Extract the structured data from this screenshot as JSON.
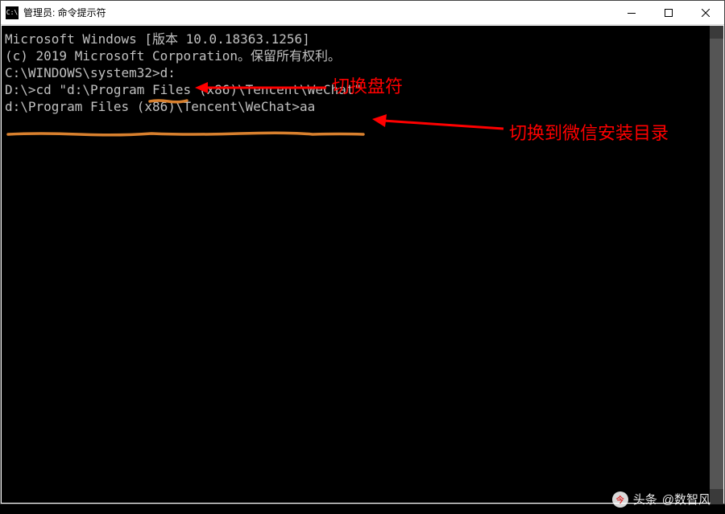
{
  "window": {
    "title": "管理员: 命令提示符",
    "icon_label": "C:\\"
  },
  "terminal": {
    "lines": [
      "Microsoft Windows [版本 10.0.18363.1256]",
      "(c) 2019 Microsoft Corporation。保留所有权利。",
      "",
      "C:\\WINDOWS\\system32>d:",
      "",
      "D:\\>cd \"d:\\Program Files (x86)\\Tencent\\WeChat\"",
      "",
      "d:\\Program Files (x86)\\Tencent\\WeChat>aa"
    ]
  },
  "annotations": {
    "a1": "切换盘符",
    "a2": "切换到微信安装目录"
  },
  "watermark": {
    "brand": "头条",
    "handle": "@数智风"
  },
  "colors": {
    "annotation": "#ff0000",
    "underline": "#d8802e",
    "terminal_text": "#c0c0c0",
    "terminal_bg": "#000000"
  }
}
